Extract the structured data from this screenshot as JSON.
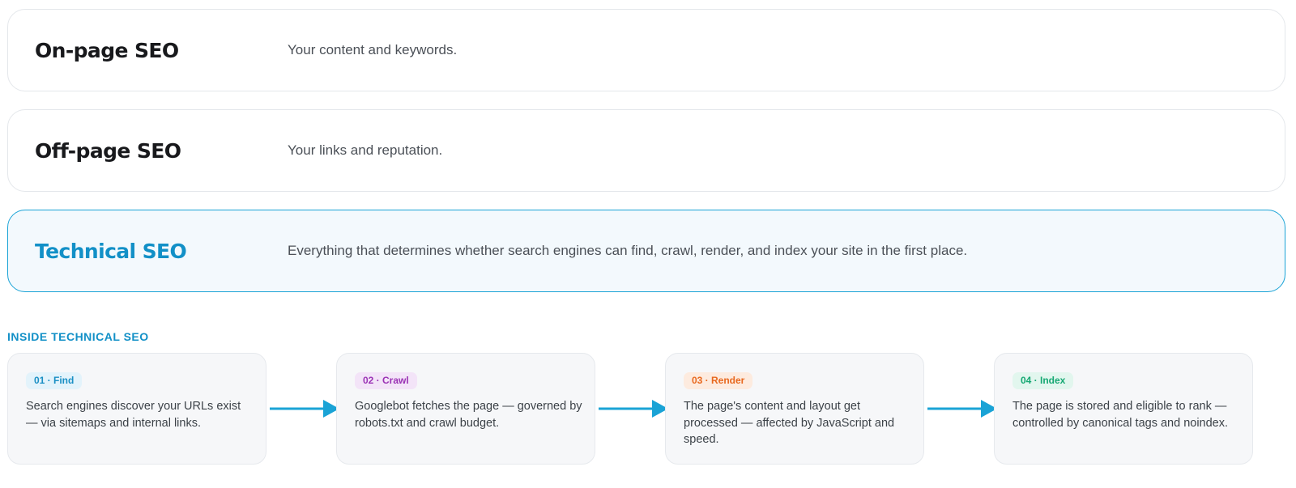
{
  "tiers": [
    {
      "title": "On-page SEO",
      "description": "Your content and keywords."
    },
    {
      "title": "Off-page SEO",
      "description": "Your links and reputation."
    },
    {
      "title": "Technical SEO",
      "description": "Everything that determines whether search engines can find, crawl, render, and index your site in the first place."
    }
  ],
  "section_label": "INSIDE TECHNICAL SEO",
  "steps": [
    {
      "badge": "01 · Find",
      "text": "Search engines discover your URLs exist — via sitemaps and internal links.",
      "badge_color": "#1a8fc4",
      "badge_bg": "#e3f3fb"
    },
    {
      "badge": "02 · Crawl",
      "text": "Googlebot fetches the page — governed by robots.txt and crawl budget.",
      "badge_color": "#9b33b5",
      "badge_bg": "#f3e4f8"
    },
    {
      "badge": "03 · Render",
      "text": "The page's content and layout get processed — affected by JavaScript and speed.",
      "badge_color": "#e8681e",
      "badge_bg": "#fdebdf"
    },
    {
      "badge": "04 · Index",
      "text": "The page is stored and eligible to rank — controlled by canonical tags and noindex.",
      "badge_color": "#16a873",
      "badge_bg": "#e2f6ee"
    }
  ],
  "colors": {
    "accent": "#1290c7",
    "arrow": "#1aa3d6",
    "active_border": "#1aa3d6",
    "active_bg": "#f3f9fd"
  }
}
